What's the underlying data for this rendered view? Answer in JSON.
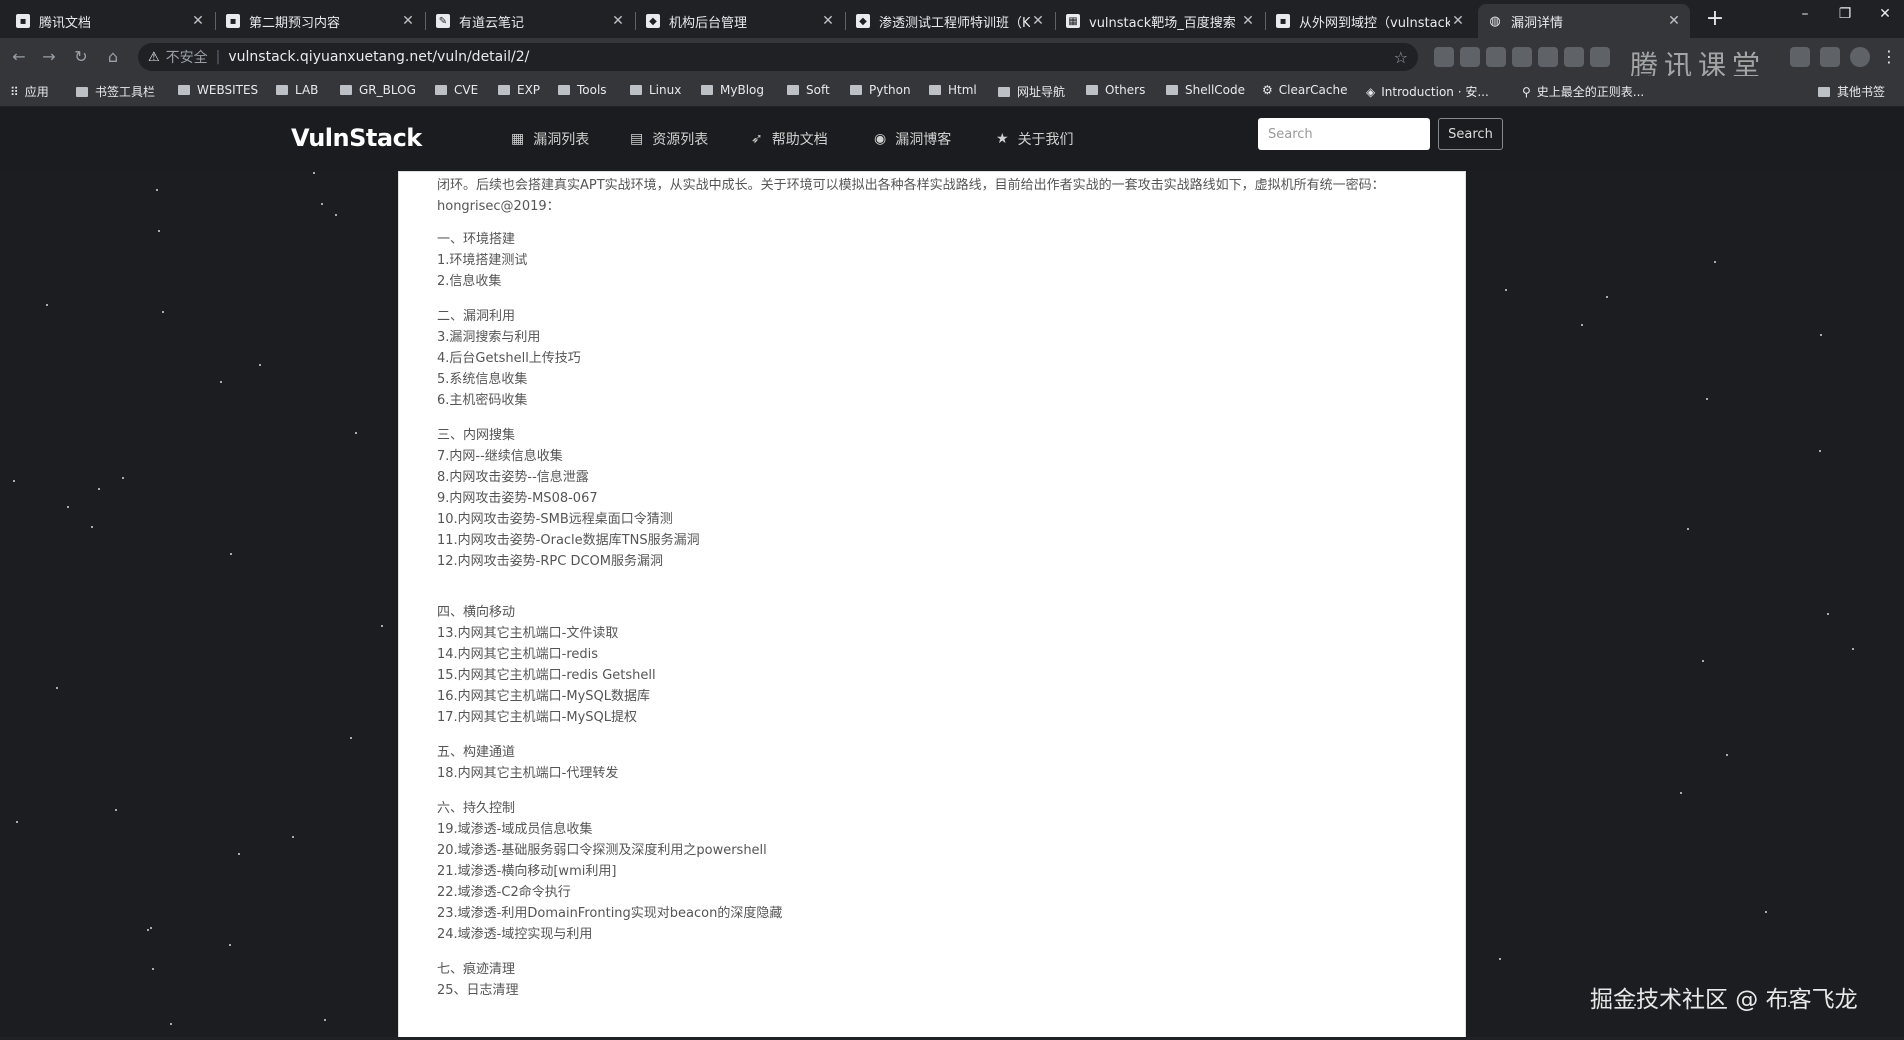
{
  "browser": {
    "tabs": [
      {
        "title": "腾讯文档",
        "icon": "doc-icon",
        "active": false
      },
      {
        "title": "第二期预习内容",
        "icon": "doc-icon",
        "active": false
      },
      {
        "title": "有道云笔记",
        "icon": "note-icon",
        "active": false
      },
      {
        "title": "机构后台管理",
        "icon": "shield-icon",
        "active": false
      },
      {
        "title": "渗透测试工程师特训班（K...",
        "icon": "shield-icon",
        "active": false
      },
      {
        "title": "vulnstack靶场_百度搜索",
        "icon": "baidu-icon",
        "active": false
      },
      {
        "title": "从外网到域控（vulnstack靶...",
        "icon": "doc-icon",
        "active": false
      },
      {
        "title": "漏洞详情",
        "icon": "globe-icon",
        "active": true
      }
    ],
    "new_tab_label": "+",
    "window_controls": {
      "minimize": "–",
      "maximize": "❐",
      "close": "✕"
    },
    "address_bar": {
      "security_label": "不安全",
      "url": "vulnstack.qiyuanxuetang.net/vuln/detail/2/"
    },
    "overlay_brand": "腾讯课堂",
    "bookmarks": [
      {
        "label": "应用",
        "type": "apps"
      },
      {
        "label": "书签工具栏",
        "type": "folder"
      },
      {
        "label": "WEBSITES",
        "type": "folder"
      },
      {
        "label": "LAB",
        "type": "folder"
      },
      {
        "label": "GR_BLOG",
        "type": "folder"
      },
      {
        "label": "CVE",
        "type": "folder"
      },
      {
        "label": "EXP",
        "type": "folder"
      },
      {
        "label": "Tools",
        "type": "folder"
      },
      {
        "label": "Linux",
        "type": "folder"
      },
      {
        "label": "MyBlog",
        "type": "folder"
      },
      {
        "label": "Soft",
        "type": "folder"
      },
      {
        "label": "Python",
        "type": "folder"
      },
      {
        "label": "Html",
        "type": "folder"
      },
      {
        "label": "网址导航",
        "type": "folder"
      },
      {
        "label": "Others",
        "type": "folder"
      },
      {
        "label": "ShellCode",
        "type": "folder"
      },
      {
        "label": "ClearCache",
        "type": "link"
      },
      {
        "label": "Introduction · 安...",
        "type": "link"
      },
      {
        "label": "史上最全的正则表...",
        "type": "link"
      },
      {
        "label": "其他书签",
        "type": "folder"
      }
    ]
  },
  "site": {
    "logo": "VulnStack",
    "nav": [
      {
        "label": "漏洞列表",
        "icon": "grid-icon"
      },
      {
        "label": "资源列表",
        "icon": "pdf-icon"
      },
      {
        "label": "帮助文档",
        "icon": "paper-plane-icon"
      },
      {
        "label": "漏洞博客",
        "icon": "eye-icon"
      },
      {
        "label": "关于我们",
        "icon": "star-icon"
      }
    ],
    "search_placeholder": "Search",
    "search_button": "Search"
  },
  "content": {
    "intro_line1": "闭环。后续也会搭建真实APT实战环境，从实战中成长。关于环境可以模拟出各种各样实战路线，目前给出作者实战的一套攻击实战路线如下，虚拟机所有统一密码：",
    "intro_line2": "hongrisec@2019：",
    "sections": [
      {
        "heading": "一、环境搭建",
        "items": [
          "1.环境搭建测试",
          "2.信息收集"
        ]
      },
      {
        "heading": "二、漏洞利用",
        "items": [
          "3.漏洞搜索与利用",
          "4.后台Getshell上传技巧",
          "5.系统信息收集",
          "6.主机密码收集"
        ]
      },
      {
        "heading": "三、内网搜集",
        "items": [
          "7.内网--继续信息收集",
          "8.内网攻击姿势--信息泄露",
          "9.内网攻击姿势-MS08-067",
          "10.内网攻击姿势-SMB远程桌面口令猜测",
          "11.内网攻击姿势-Oracle数据库TNS服务漏洞",
          "12.内网攻击姿势-RPC DCOM服务漏洞"
        ]
      },
      {
        "heading": "四、横向移动",
        "items": [
          "13.内网其它主机端口-文件读取",
          "14.内网其它主机端口-redis",
          "15.内网其它主机端口-redis Getshell",
          "16.内网其它主机端口-MySQL数据库",
          "17.内网其它主机端口-MySQL提权"
        ]
      },
      {
        "heading": "五、构建通道",
        "items": [
          "18.内网其它主机端口-代理转发"
        ]
      },
      {
        "heading": "六、持久控制",
        "items": [
          "19.域渗透-域成员信息收集",
          "20.域渗透-基础服务弱口令探测及深度利用之powershell",
          "21.域渗透-横向移动[wmi利用]",
          "22.域渗透-C2命令执行",
          "23.域渗透-利用DomainFronting实现对beacon的深度隐藏",
          "24.域渗透-域控实现与利用"
        ]
      },
      {
        "heading": "七、痕迹清理",
        "items": [
          "25、日志清理"
        ]
      }
    ]
  },
  "watermark": "掘金技术社区 @ 布客飞龙"
}
